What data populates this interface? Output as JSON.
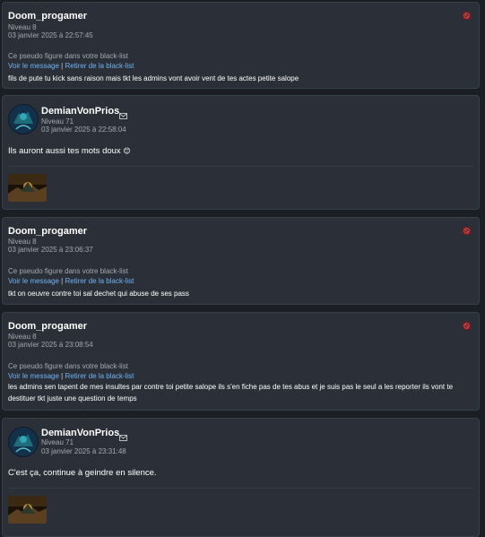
{
  "blacklist": {
    "note": "Ce pseudo figure dans votre black-list",
    "view_label": "Voir le message",
    "separator": "|",
    "remove_label": "Retirer de la black-list"
  },
  "posts": [
    {
      "pseudo": "Doom_progamer",
      "level": "Niveau 8",
      "date": "03 janvier 2025 à 22:57:45",
      "text": "fils de pute tu kick sans raison mais tkt les admins vont avoir vent de tes actes petite salope"
    },
    {
      "pseudo": "DemianVonPrios",
      "level": "Niveau 71",
      "date": "03 janvier 2025 à 22:58:04",
      "text": "Ils auront aussi tes mots doux",
      "emoji": "😊"
    },
    {
      "pseudo": "Doom_progamer",
      "level": "Niveau 8",
      "date": "03 janvier 2025 à 23:06:37",
      "text": "tkt on oeuvre contre toi sal dechet qui abuse de ses pass"
    },
    {
      "pseudo": "Doom_progamer",
      "level": "Niveau 8",
      "date": "03 janvier 2025 à 23:08:54",
      "text": "les admins sen tapent de mes insultes par contre toi petite salope ils s'en fiche pas de tes abus et je suis pas le seul a les reporter ils vont te destituer tkt juste une question de temps"
    },
    {
      "pseudo": "DemianVonPrios",
      "level": "Niveau 71",
      "date": "03 janvier 2025 à 23:31:48",
      "text": "C'est ça, continue à geindre en silence."
    }
  ],
  "colors": {
    "background": "#1b1e23",
    "card": "#2b3038",
    "link": "#6fb3f5",
    "report": "#6b1c23"
  }
}
